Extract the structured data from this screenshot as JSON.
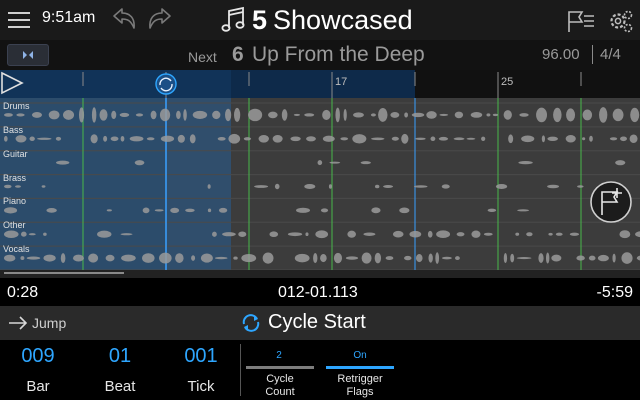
{
  "header": {
    "time": "9:51am",
    "song_number": "5",
    "song_title": "Showcased"
  },
  "next": {
    "label": "Next",
    "song_number": "6",
    "song_title": "Up From the Deep",
    "tempo": "96.00",
    "time_signature": "4/4"
  },
  "ruler": {
    "bars": [
      "17",
      "25"
    ]
  },
  "tracks": [
    {
      "label": "Drums"
    },
    {
      "label": "Bass"
    },
    {
      "label": "Guitar"
    },
    {
      "label": "Brass"
    },
    {
      "label": "Piano"
    },
    {
      "label": "Other"
    },
    {
      "label": "Vocals"
    }
  ],
  "playback": {
    "progress": 0.19
  },
  "position_row": {
    "elapsed": "0:28",
    "position": "012-01.113",
    "remaining": "-5:59"
  },
  "jump_row": {
    "jump_label": "Jump",
    "cycle_title": "Cycle Start"
  },
  "fields": {
    "bar": {
      "value": "009",
      "label": "Bar"
    },
    "beat": {
      "value": "01",
      "label": "Beat"
    },
    "tick": {
      "value": "001",
      "label": "Tick"
    },
    "cycle_count": {
      "value": "2",
      "label_line1": "Cycle",
      "label_line2": "Count"
    },
    "retrigger_flags": {
      "value": "On",
      "label_line1": "Retrigger",
      "label_line2": "Flags"
    }
  },
  "colors": {
    "accent": "#2ea6ff",
    "cycle_region": "#2f4f6f",
    "playhead": "#3aa0ff",
    "beat_marker": "#47b84a"
  }
}
